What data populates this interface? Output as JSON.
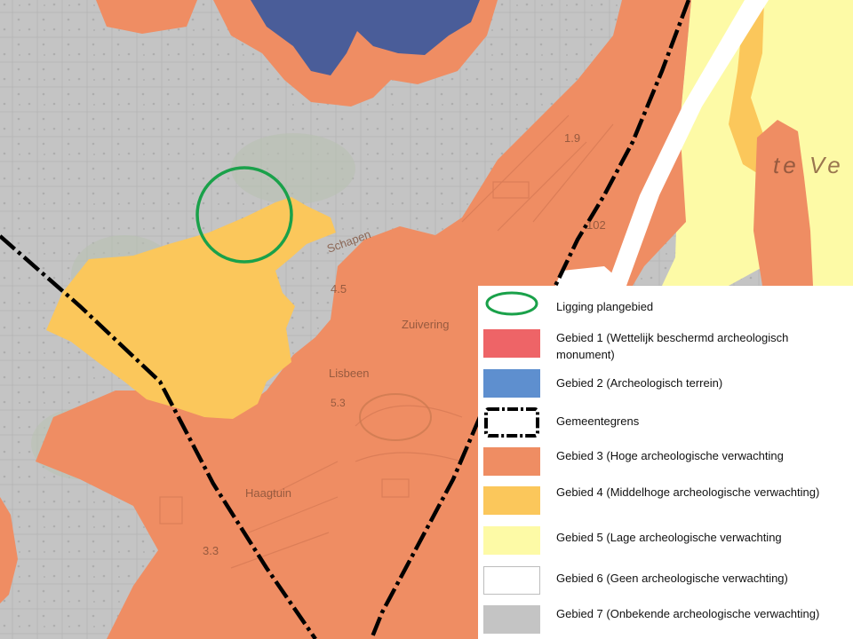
{
  "map": {
    "labels": [
      "1.9",
      "102",
      "Schapen",
      "4.5",
      "Zuivering",
      "Lisbeen",
      "5.3",
      "Haagtuin",
      "3.3",
      "te Ve"
    ]
  },
  "legend": {
    "items": [
      {
        "label": "Ligging plangebied",
        "symbol": "ellipse-outline",
        "color": "#1aa14a"
      },
      {
        "label": "Gebied 1 (Wettelijk beschermd archeologisch monument)",
        "symbol": "fill",
        "color": "#ee6467"
      },
      {
        "label": "Gebied 2 (Archeologisch terrein)",
        "symbol": "fill",
        "color": "#5e8fcf"
      },
      {
        "label": "Gemeentegrens",
        "symbol": "dashed-outline",
        "color": "#000000"
      },
      {
        "label": "Gebied 3 (Hoge archeologische verwachting",
        "symbol": "fill",
        "color": "#ef8d63"
      },
      {
        "label": "Gebied 4 (Middelhoge archeologische verwachting)",
        "symbol": "fill",
        "color": "#fbc75b"
      },
      {
        "label": "Gebied 5 (Lage archeologische verwachting",
        "symbol": "fill",
        "color": "#fdfaa6"
      },
      {
        "label": "Gebied 6 (Geen archeologische verwachting)",
        "symbol": "fill",
        "color": "#ffffff"
      },
      {
        "label": "Gebied 7 (Onbekende archeologische verwachting)",
        "symbol": "fill",
        "color": "#c4c4c4"
      }
    ]
  }
}
